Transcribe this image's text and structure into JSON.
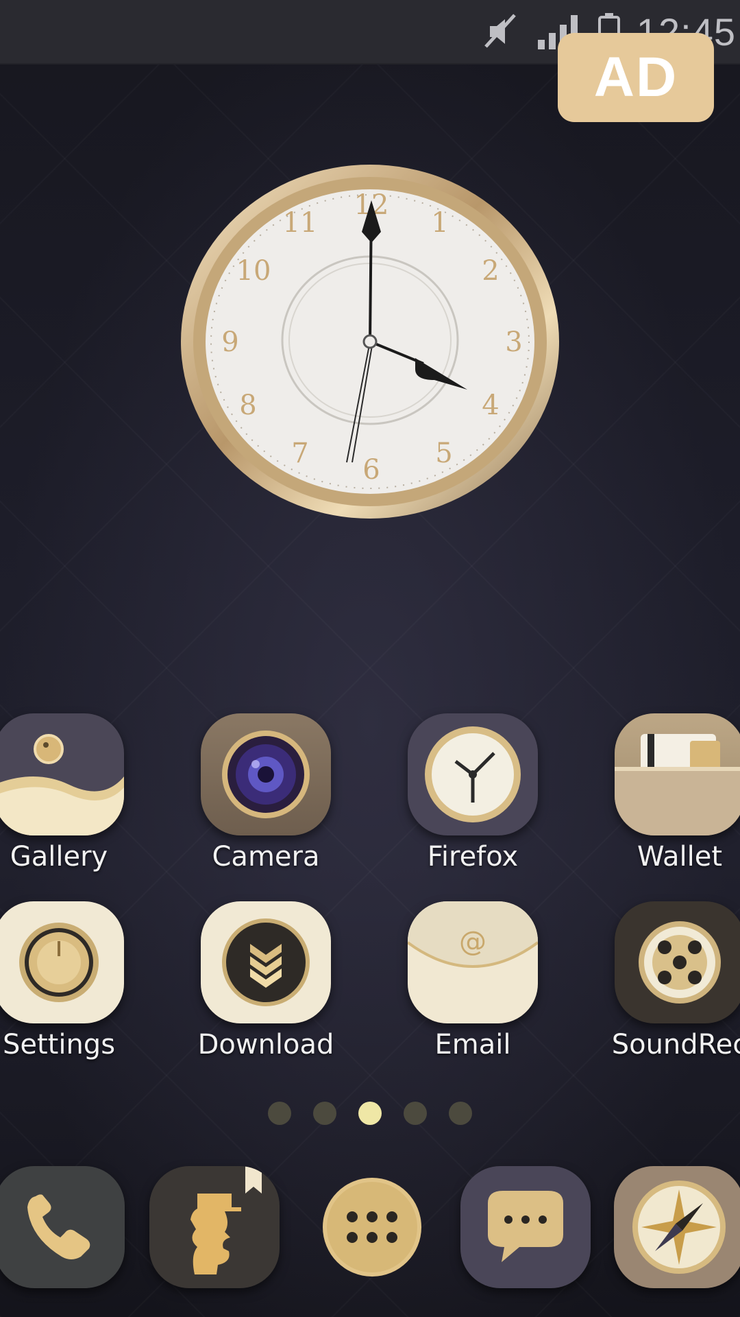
{
  "status_bar": {
    "time": "12:45",
    "icons": [
      "mute-icon",
      "signal-icon",
      "battery-icon"
    ]
  },
  "ad_badge": {
    "label": "AD"
  },
  "clock": {
    "numerals": [
      "12",
      "1",
      "2",
      "3",
      "4",
      "5",
      "6",
      "7",
      "8",
      "9",
      "10",
      "11"
    ]
  },
  "apps": [
    {
      "label": "Gallery",
      "icon": "gallery-icon"
    },
    {
      "label": "Camera",
      "icon": "camera-icon"
    },
    {
      "label": "Firefox",
      "icon": "clock-icon"
    },
    {
      "label": "Wallet",
      "icon": "wallet-icon"
    },
    {
      "label": "Settings",
      "icon": "settings-icon"
    },
    {
      "label": "Download",
      "icon": "download-icon"
    },
    {
      "label": "Email",
      "icon": "email-icon"
    },
    {
      "label": "SoundRec",
      "icon": "soundrec-icon"
    }
  ],
  "page_indicator": {
    "count": 5,
    "active_index": 2
  },
  "dock": [
    {
      "icon": "phone-icon"
    },
    {
      "icon": "contacts-icon"
    },
    {
      "icon": "app-drawer-icon"
    },
    {
      "icon": "messages-icon"
    },
    {
      "icon": "compass-icon"
    }
  ],
  "colors": {
    "gold": "#d9bb84",
    "cream": "#f3ecd9",
    "dark_purple": "#4a4658",
    "ad_badge": "#e6c99a",
    "active_dot": "#efe7a6"
  }
}
